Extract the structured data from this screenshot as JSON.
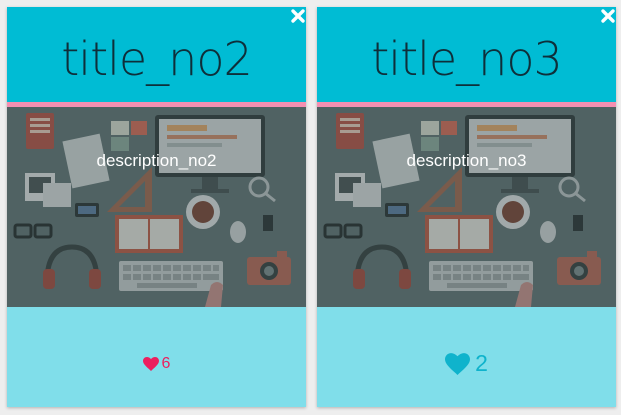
{
  "cards": [
    {
      "title": "title_no2",
      "description": "description_no2",
      "likes": "6",
      "heart_color": "#ec1f5e"
    },
    {
      "title": "title_no3",
      "description": "description_no3",
      "likes": "2",
      "heart_color": "#0fb3cc"
    }
  ],
  "colors": {
    "header": "#00bcd4",
    "footer": "#80deea",
    "divider": "#f48fb1",
    "title_text": "#0e2f3a"
  },
  "icons": {
    "close": "close-icon",
    "like": "heart-icon",
    "image": "desk-workspace-illustration"
  }
}
